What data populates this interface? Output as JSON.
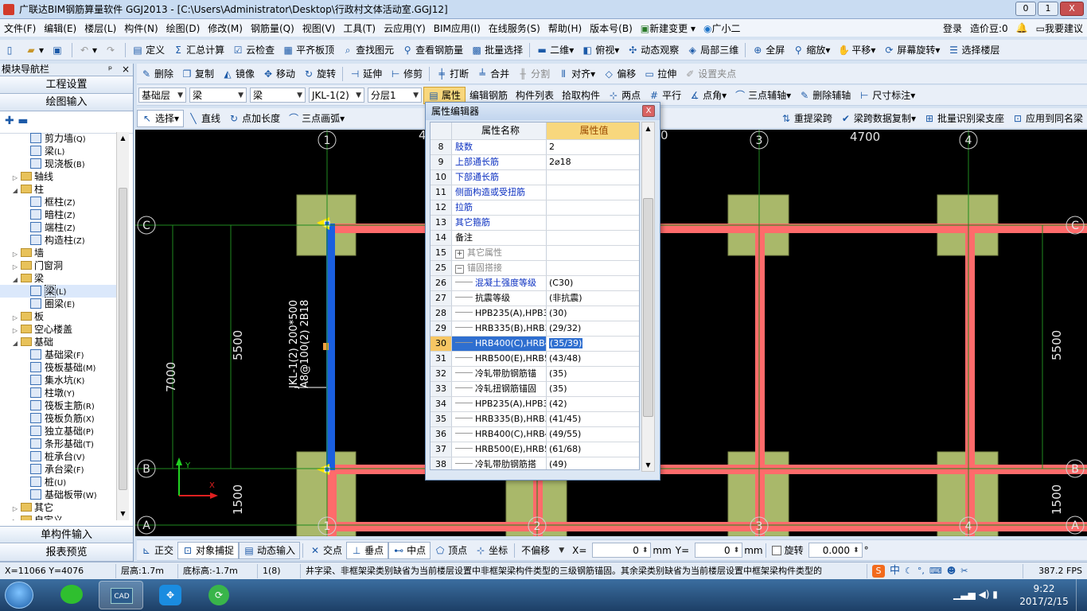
{
  "app": {
    "title": "广联达BIM钢筋算量软件 GGJ2013 - [C:\\Users\\Administrator\\Desktop\\行政村文体活动室.GGJ12]",
    "min": "0",
    "restore": "1",
    "close": "X"
  },
  "menu": [
    "文件(F)",
    "编辑(E)",
    "楼层(L)",
    "构件(N)",
    "绘图(D)",
    "修改(M)",
    "钢筋量(Q)",
    "视图(V)",
    "工具(T)",
    "云应用(Y)",
    "BIM应用(I)",
    "在线服务(S)",
    "帮助(H)",
    "版本号(B)",
    "新建变更",
    "广小二"
  ],
  "menu_right": {
    "login": "登录",
    "coins": "造价豆:0",
    "suggest": "我要建议"
  },
  "toolbar1": [
    "定义",
    "汇总计算",
    "云检查",
    "平齐板顶",
    "查找图元",
    "查看钢筋量",
    "批量选择",
    "二维",
    "俯视",
    "动态观察",
    "局部三维",
    "全屏",
    "缩放",
    "平移",
    "屏幕旋转",
    "选择楼层"
  ],
  "toolbar2": [
    "删除",
    "复制",
    "镜像",
    "移动",
    "旋转",
    "延伸",
    "修剪",
    "打断",
    "合并",
    "分割",
    "对齐",
    "偏移",
    "拉伸",
    "设置夹点"
  ],
  "toolbar3": {
    "floor": "基础层",
    "type1": "梁",
    "type2": "梁",
    "comp": "JKL-1(2)",
    "layer": "分层1",
    "props": "属性",
    "edit_rebar": "编辑钢筋",
    "comp_list": "构件列表",
    "pick": "拾取构件",
    "two_pt": "两点",
    "parallel": "平行",
    "point_angle": "点角",
    "three_pt": "三点辅轴",
    "del_axis": "删除辅轴",
    "dim": "尺寸标注"
  },
  "toolbar4": [
    "选择",
    "直线",
    "点加长度",
    "三点画弧",
    "重提梁跨",
    "梁跨数据复制",
    "批量识别梁支座",
    "应用到同名梁"
  ],
  "leftpanel": {
    "title": "模块导航栏",
    "pin": "ᵖ",
    "close": "×",
    "nav1": "工程设置",
    "nav2": "绘图输入",
    "nav3": "单构件输入",
    "nav4": "报表预览"
  },
  "tree": [
    {
      "label": "剪力墙",
      "key": "(Q)",
      "lvl": 2,
      "ic": "c"
    },
    {
      "label": "梁",
      "key": "(L)",
      "lvl": 2,
      "ic": "c"
    },
    {
      "label": "现浇板",
      "key": "(B)",
      "lvl": 2,
      "ic": "c"
    },
    {
      "label": "轴线",
      "key": "",
      "lvl": 1,
      "ic": "f",
      "tw": "▷"
    },
    {
      "label": "柱",
      "key": "",
      "lvl": 1,
      "ic": "f",
      "tw": "◢"
    },
    {
      "label": "框柱",
      "key": "(Z)",
      "lvl": 2,
      "ic": "c"
    },
    {
      "label": "暗柱",
      "key": "(Z)",
      "lvl": 2,
      "ic": "c"
    },
    {
      "label": "端柱",
      "key": "(Z)",
      "lvl": 2,
      "ic": "c"
    },
    {
      "label": "构造柱",
      "key": "(Z)",
      "lvl": 2,
      "ic": "c"
    },
    {
      "label": "墙",
      "key": "",
      "lvl": 1,
      "ic": "f",
      "tw": "▷"
    },
    {
      "label": "门窗洞",
      "key": "",
      "lvl": 1,
      "ic": "f",
      "tw": "▷"
    },
    {
      "label": "梁",
      "key": "",
      "lvl": 1,
      "ic": "f",
      "tw": "◢"
    },
    {
      "label": "梁",
      "key": "(L)",
      "lvl": 2,
      "ic": "c",
      "sel": true
    },
    {
      "label": "圈梁",
      "key": "(E)",
      "lvl": 2,
      "ic": "c"
    },
    {
      "label": "板",
      "key": "",
      "lvl": 1,
      "ic": "f",
      "tw": "▷"
    },
    {
      "label": "空心楼盖",
      "key": "",
      "lvl": 1,
      "ic": "f",
      "tw": "▷"
    },
    {
      "label": "基础",
      "key": "",
      "lvl": 1,
      "ic": "f",
      "tw": "◢"
    },
    {
      "label": "基础梁",
      "key": "(F)",
      "lvl": 2,
      "ic": "c"
    },
    {
      "label": "筏板基础",
      "key": "(M)",
      "lvl": 2,
      "ic": "c"
    },
    {
      "label": "集水坑",
      "key": "(K)",
      "lvl": 2,
      "ic": "c"
    },
    {
      "label": "柱墩",
      "key": "(Y)",
      "lvl": 2,
      "ic": "c"
    },
    {
      "label": "筏板主筋",
      "key": "(R)",
      "lvl": 2,
      "ic": "c"
    },
    {
      "label": "筏板负筋",
      "key": "(X)",
      "lvl": 2,
      "ic": "c"
    },
    {
      "label": "独立基础",
      "key": "(P)",
      "lvl": 2,
      "ic": "c"
    },
    {
      "label": "条形基础",
      "key": "(T)",
      "lvl": 2,
      "ic": "c"
    },
    {
      "label": "桩承台",
      "key": "(V)",
      "lvl": 2,
      "ic": "c"
    },
    {
      "label": "承台梁",
      "key": "(F)",
      "lvl": 2,
      "ic": "c"
    },
    {
      "label": "桩",
      "key": "(U)",
      "lvl": 2,
      "ic": "c"
    },
    {
      "label": "基础板带",
      "key": "(W)",
      "lvl": 2,
      "ic": "c"
    },
    {
      "label": "其它",
      "key": "",
      "lvl": 1,
      "ic": "f",
      "tw": "▷"
    },
    {
      "label": "自定义",
      "key": "",
      "lvl": 1,
      "ic": "f",
      "tw": "▷"
    }
  ],
  "dialog": {
    "title": "属性编辑器",
    "close": "X",
    "col_name": "属性名称",
    "col_value": "属性值",
    "rows": [
      {
        "n": "8",
        "name": "肢数",
        "val": "2",
        "link": true
      },
      {
        "n": "9",
        "name": "上部通长筋",
        "val": "2⌀18",
        "link": true
      },
      {
        "n": "10",
        "name": "下部通长筋",
        "val": "",
        "link": true
      },
      {
        "n": "11",
        "name": "侧面构造或受扭筋",
        "val": "",
        "link": true
      },
      {
        "n": "12",
        "name": "拉筋",
        "val": "",
        "link": true
      },
      {
        "n": "13",
        "name": "其它箍筋",
        "val": "",
        "link": true
      },
      {
        "n": "14",
        "name": "备注",
        "val": ""
      },
      {
        "n": "15",
        "name": "其它属性",
        "val": "",
        "grp": "+"
      },
      {
        "n": "25",
        "name": "锚固搭接",
        "val": "",
        "grp": "−"
      },
      {
        "n": "26",
        "name": "混凝土强度等级",
        "val": "(C30)",
        "ind": true,
        "link": true
      },
      {
        "n": "27",
        "name": "抗震等级",
        "val": "(非抗震)",
        "ind": true
      },
      {
        "n": "28",
        "name": "HPB235(A),HPB3",
        "val": "(30)",
        "ind": true
      },
      {
        "n": "29",
        "name": "HRB335(B),HRB3",
        "val": "(29/32)",
        "ind": true
      },
      {
        "n": "30",
        "name": "HRB400(C),HRB4",
        "val": "(35/39)",
        "ind": true,
        "sel": true
      },
      {
        "n": "31",
        "name": "HRB500(E),HRB5",
        "val": "(43/48)",
        "ind": true
      },
      {
        "n": "32",
        "name": "冷轧带肋钢筋锚",
        "val": "(35)",
        "ind": true
      },
      {
        "n": "33",
        "name": "冷轧扭钢筋锚固",
        "val": "(35)",
        "ind": true
      },
      {
        "n": "34",
        "name": "HPB235(A),HPB3",
        "val": "(42)",
        "ind": true
      },
      {
        "n": "35",
        "name": "HRB335(B),HRB3",
        "val": "(41/45)",
        "ind": true
      },
      {
        "n": "36",
        "name": "HRB400(C),HRB4",
        "val": "(49/55)",
        "ind": true
      },
      {
        "n": "37",
        "name": "HRB500(E),HRB5",
        "val": "(61/68)",
        "ind": true
      },
      {
        "n": "38",
        "name": "冷轧带肋钢筋搭",
        "val": "(49)",
        "ind": true
      }
    ]
  },
  "canvas": {
    "axis_top": [
      "1",
      "3",
      "4"
    ],
    "axis_bottom": [
      "1",
      "2",
      "3",
      "4"
    ],
    "axis_left": [
      "C",
      "B",
      "A"
    ],
    "axis_right": [
      "C",
      "B",
      "A"
    ],
    "dim_top_frag": "4",
    "dim_top_2": "0",
    "dim_top_34": "4700",
    "dim_left_outer": "7000",
    "dim_left_cb": "5500",
    "dim_left_ba": "1500",
    "dim_right_cb": "5500",
    "dim_right_ba": "1500",
    "beam_label_1": "JKL-1(2) 200*500",
    "beam_label_2": "A8@100(2) 2B18",
    "ucs_x": "X",
    "ucs_y": "Y"
  },
  "bottombar": {
    "ortho": "正交",
    "snap": "对象捕捉",
    "dyn": "动态输入",
    "inter": "交点",
    "perp": "垂点",
    "mid": "中点",
    "vertex": "顶点",
    "coord": "坐标",
    "offset": "不偏移",
    "x_label": "X=",
    "x_val": "0",
    "mm1": "mm",
    "y_label": "Y=",
    "y_val": "0",
    "mm2": "mm",
    "rotate": "旋转",
    "rot_val": "0.000",
    "deg": "°"
  },
  "status": {
    "coord": "X=11066 Y=4076",
    "floor_h": "层高:1.7m",
    "bottom_h": "底标高:-1.7m",
    "count": "1(8)",
    "msg": "井字梁、非框架梁类别缺省为当前楼层设置中非框架梁构件类型的三级钢筋锚固。其余梁类别缺省为当前楼层设置中框架梁构件类型的",
    "fps": "387.2 FPS"
  },
  "ime": {
    "zh": "中",
    "punct": "°,"
  },
  "taskbar": {
    "time": "9:22",
    "date": "2017/2/15",
    "cad": "CAD"
  },
  "colors": {
    "canvas_bg": "#000000",
    "grid": "#1f8a1f",
    "beam": "#ff6b6b",
    "beam_sel": "#1a5fe0",
    "column": "#a9b86a",
    "accent": "#2f6fd0"
  }
}
